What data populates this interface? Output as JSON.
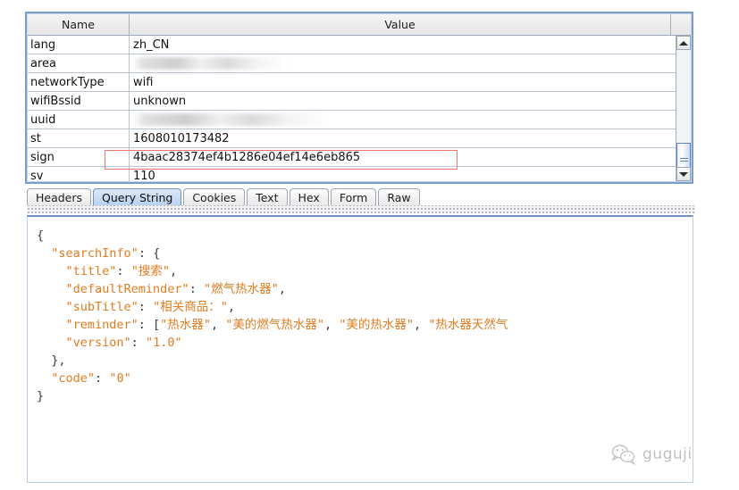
{
  "table": {
    "columns": [
      "Name",
      "Value"
    ],
    "rows": [
      {
        "name": "lang",
        "value": "zh_CN",
        "redacted": false
      },
      {
        "name": "area",
        "value": "",
        "redacted": true
      },
      {
        "name": "networkType",
        "value": "wifi",
        "redacted": false
      },
      {
        "name": "wifiBssid",
        "value": "unknown",
        "redacted": false
      },
      {
        "name": "uuid",
        "value": "",
        "redacted": true
      },
      {
        "name": "st",
        "value": "1608010173482",
        "redacted": false
      },
      {
        "name": "sign",
        "value": "4baac28374ef4b1286e04ef14e6eb865",
        "redacted": false,
        "highlighted": true
      },
      {
        "name": "sv",
        "value": "110",
        "redacted": false
      }
    ]
  },
  "scrollbar": {
    "up_icon": "arrow-up-icon",
    "down_icon": "arrow-down-icon"
  },
  "tabs": [
    {
      "label": "Headers",
      "selected": false
    },
    {
      "label": "Query String",
      "selected": true
    },
    {
      "label": "Cookies",
      "selected": false
    },
    {
      "label": "Text",
      "selected": false
    },
    {
      "label": "Hex",
      "selected": false
    },
    {
      "label": "Form",
      "selected": false
    },
    {
      "label": "Raw",
      "selected": false
    }
  ],
  "body": {
    "lines": [
      [
        {
          "t": "{",
          "c": "punct"
        }
      ],
      [
        {
          "t": "  ",
          "c": "punct"
        },
        {
          "t": "\"searchInfo\"",
          "c": "tok"
        },
        {
          "t": ": {",
          "c": "punct"
        }
      ],
      [
        {
          "t": "    ",
          "c": "punct"
        },
        {
          "t": "\"title\"",
          "c": "tok"
        },
        {
          "t": ": ",
          "c": "punct"
        },
        {
          "t": "\"搜索\"",
          "c": "tok"
        },
        {
          "t": ",",
          "c": "punct"
        }
      ],
      [
        {
          "t": "    ",
          "c": "punct"
        },
        {
          "t": "\"defaultReminder\"",
          "c": "tok"
        },
        {
          "t": ": ",
          "c": "punct"
        },
        {
          "t": "\"燃气热水器\"",
          "c": "tok"
        },
        {
          "t": ",",
          "c": "punct"
        }
      ],
      [
        {
          "t": "    ",
          "c": "punct"
        },
        {
          "t": "\"subTitle\"",
          "c": "tok"
        },
        {
          "t": ": ",
          "c": "punct"
        },
        {
          "t": "\"相关商品：\"",
          "c": "tok"
        },
        {
          "t": ",",
          "c": "punct"
        }
      ],
      [
        {
          "t": "    ",
          "c": "punct"
        },
        {
          "t": "\"reminder\"",
          "c": "tok"
        },
        {
          "t": ": [",
          "c": "punct"
        },
        {
          "t": "\"热水器\"",
          "c": "tok"
        },
        {
          "t": ", ",
          "c": "punct"
        },
        {
          "t": "\"美的燃气热水器\"",
          "c": "tok"
        },
        {
          "t": ", ",
          "c": "punct"
        },
        {
          "t": "\"美的热水器\"",
          "c": "tok"
        },
        {
          "t": ", ",
          "c": "punct"
        },
        {
          "t": "\"热水器天然气",
          "c": "tok"
        }
      ],
      [
        {
          "t": "    ",
          "c": "punct"
        },
        {
          "t": "\"version\"",
          "c": "tok"
        },
        {
          "t": ": ",
          "c": "punct"
        },
        {
          "t": "\"1.0\"",
          "c": "tok"
        }
      ],
      [
        {
          "t": "  },",
          "c": "punct"
        }
      ],
      [
        {
          "t": "  ",
          "c": "punct"
        },
        {
          "t": "\"code\"",
          "c": "tok"
        },
        {
          "t": ": ",
          "c": "punct"
        },
        {
          "t": "\"0\"",
          "c": "tok"
        }
      ],
      [
        {
          "t": "}",
          "c": "punct"
        }
      ]
    ]
  },
  "watermark": {
    "icon": "wechat-icon",
    "label": "guguji"
  },
  "colors": {
    "panel_border": "#7b9ec8",
    "annotation_red": "#f0736e",
    "json_token": "#e07b20",
    "tab_selected": "#b7d2f0"
  }
}
